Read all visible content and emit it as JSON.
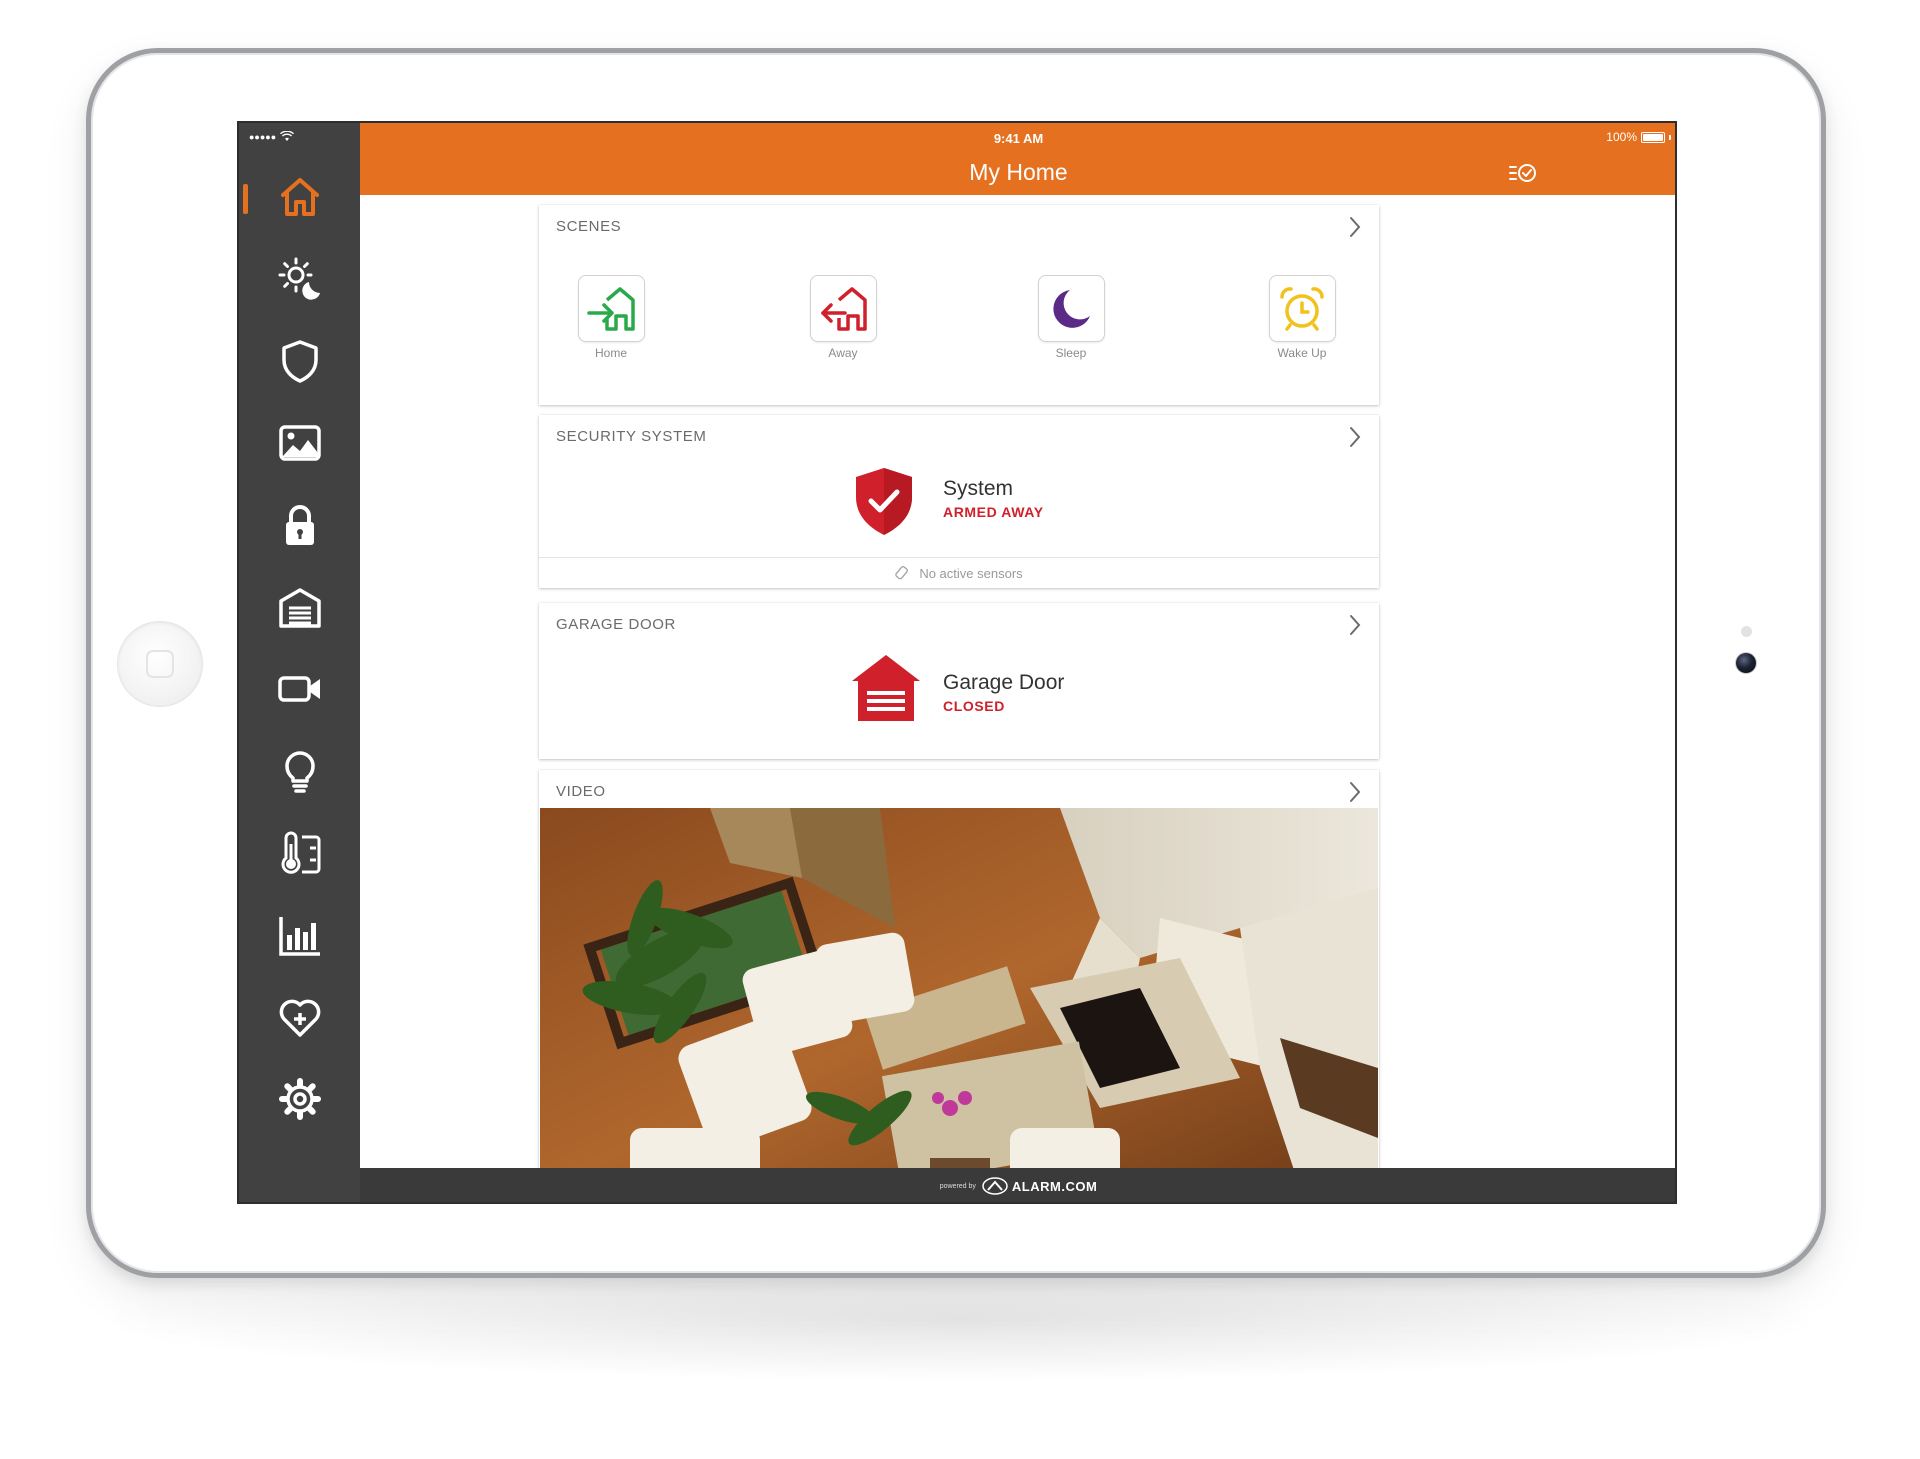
{
  "device": {
    "status_time": "9:41 AM",
    "battery": "100%",
    "signal_dots": "●●●●●"
  },
  "header": {
    "title": "My Home"
  },
  "sidebar": {
    "items": [
      {
        "name": "home-icon",
        "active": true
      },
      {
        "name": "scenes-sun-moon-icon",
        "active": false
      },
      {
        "name": "shield-icon",
        "active": false
      },
      {
        "name": "image-gallery-icon",
        "active": false
      },
      {
        "name": "lock-icon",
        "active": false
      },
      {
        "name": "garage-icon",
        "active": false
      },
      {
        "name": "video-camera-icon",
        "active": false
      },
      {
        "name": "lightbulb-icon",
        "active": false
      },
      {
        "name": "thermostat-icon",
        "active": false
      },
      {
        "name": "bar-chart-icon",
        "active": false
      },
      {
        "name": "heart-plus-icon",
        "active": false
      },
      {
        "name": "gear-icon",
        "active": false
      }
    ]
  },
  "scenes": {
    "header": "SCENES",
    "items": [
      {
        "label": "Home",
        "icon": "arrive-home-icon",
        "color": "#2aa94a"
      },
      {
        "label": "Away",
        "icon": "leave-home-icon",
        "color": "#d0202b"
      },
      {
        "label": "Sleep",
        "icon": "moon-icon",
        "color": "#5a2a86"
      },
      {
        "label": "Wake Up",
        "icon": "alarm-clock-icon",
        "color": "#f1c21b"
      }
    ]
  },
  "security": {
    "header": "SECURITY SYSTEM",
    "name": "System",
    "state": "ARMED AWAY",
    "footer": "No active sensors"
  },
  "garage": {
    "header": "GARAGE DOOR",
    "name": "Garage Door",
    "state": "CLOSED"
  },
  "video": {
    "header": "VIDEO"
  },
  "footer": {
    "powered_by": "powered by",
    "brand": "ALARM.COM"
  },
  "colors": {
    "accent": "#e5701f",
    "sidebar": "#414141",
    "alert_red": "#d0202b"
  }
}
